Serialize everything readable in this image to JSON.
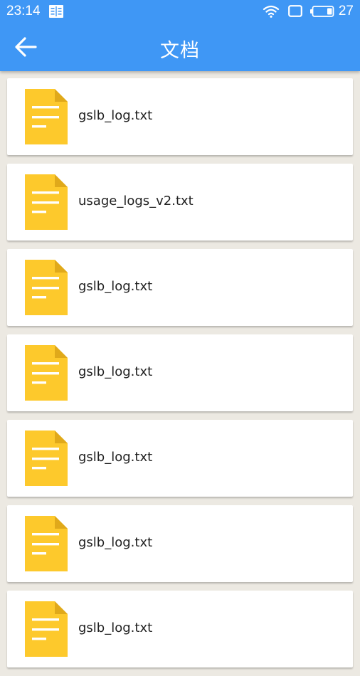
{
  "status_bar": {
    "time": "23:14",
    "notification_icon": "reader-icon",
    "wifi_icon": "wifi-icon",
    "screen_icon": "screen-icon",
    "battery_icon": "battery-icon",
    "battery_level": "27"
  },
  "toolbar": {
    "back_icon": "arrow-left-icon",
    "title": "文档"
  },
  "colors": {
    "header": "#3f97f5",
    "background": "#ece9e2",
    "doc_icon": "#fdc92c",
    "doc_fold": "#e0a91a"
  },
  "files": [
    {
      "name": "gslb_log.txt",
      "icon": "text-document-icon"
    },
    {
      "name": "usage_logs_v2.txt",
      "icon": "text-document-icon"
    },
    {
      "name": "gslb_log.txt",
      "icon": "text-document-icon"
    },
    {
      "name": "gslb_log.txt",
      "icon": "text-document-icon"
    },
    {
      "name": "gslb_log.txt",
      "icon": "text-document-icon"
    },
    {
      "name": "gslb_log.txt",
      "icon": "text-document-icon"
    },
    {
      "name": "gslb_log.txt",
      "icon": "text-document-icon"
    }
  ]
}
